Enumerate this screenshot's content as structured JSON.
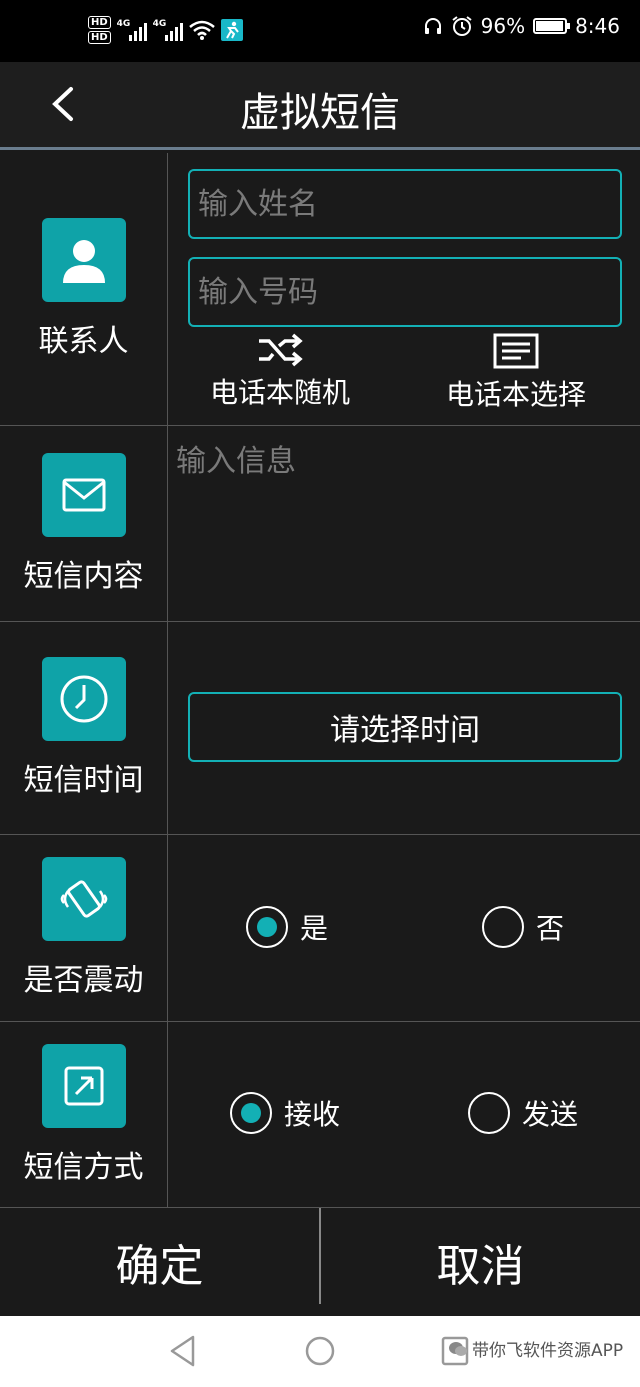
{
  "status_bar": {
    "hd1": "HD",
    "hd2": "HD",
    "net1": "4G",
    "net2": "4G",
    "battery_percent": "96%",
    "battery_level": 0.96,
    "time": "8:46"
  },
  "header": {
    "title": "虚拟短信"
  },
  "contact": {
    "label": "联系人",
    "name_placeholder": "输入姓名",
    "number_placeholder": "输入号码",
    "random_label": "电话本随机",
    "select_label": "电话本选择"
  },
  "message": {
    "label": "短信内容",
    "placeholder": "输入信息"
  },
  "time": {
    "label": "短信时间",
    "button_label": "请选择时间"
  },
  "vibrate": {
    "label": "是否震动",
    "options": [
      {
        "label": "是",
        "selected": true
      },
      {
        "label": "否",
        "selected": false
      }
    ]
  },
  "mode": {
    "label": "短信方式",
    "options": [
      {
        "label": "接收",
        "selected": true
      },
      {
        "label": "发送",
        "selected": false
      }
    ]
  },
  "actions": {
    "confirm": "确定",
    "cancel": "取消"
  },
  "watermark": "带你飞软件资源APP",
  "colors": {
    "accent": "#13b0b5",
    "tile": "#0fa3a8",
    "background": "#1a1a1a"
  }
}
